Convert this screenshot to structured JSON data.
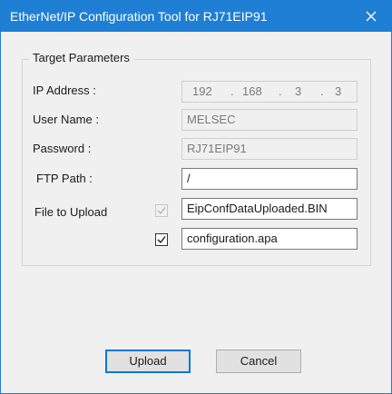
{
  "window": {
    "title": "EtherNet/IP Configuration Tool for RJ71EIP91",
    "close_icon": "close-icon"
  },
  "group": {
    "legend": "Target Parameters"
  },
  "fields": {
    "ip_address": {
      "label": "IP Address :",
      "octets": [
        "192",
        "168",
        "3",
        "3"
      ],
      "separator": "."
    },
    "user_name": {
      "label": "User Name :",
      "value": "MELSEC"
    },
    "password": {
      "label": "Password :",
      "value": "RJ71EIP91"
    },
    "ftp_path": {
      "label": "FTP Path :",
      "value": "/"
    },
    "file_to_upload": {
      "label": "File to Upload",
      "files": [
        {
          "name": "EipConfDataUploaded.BIN",
          "checked": true,
          "enabled": false
        },
        {
          "name": "configuration.apa",
          "checked": true,
          "enabled": true
        }
      ]
    }
  },
  "buttons": {
    "upload": "Upload",
    "cancel": "Cancel"
  },
  "colors": {
    "title_bar": "#1f7fd4",
    "dialog_bg": "#f0f0f0",
    "default_button_border": "#0078d7"
  }
}
